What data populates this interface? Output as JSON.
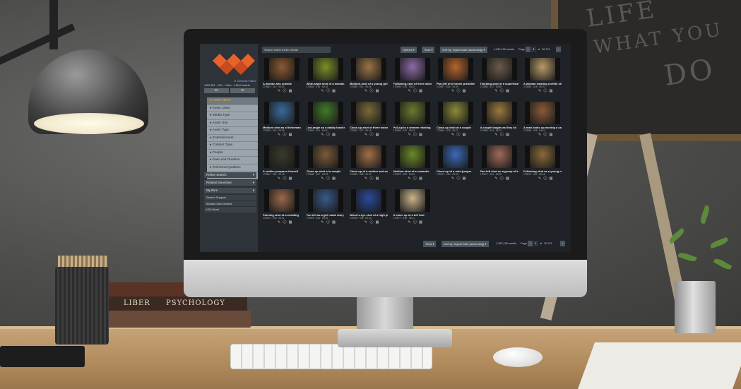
{
  "decor": {
    "chalkboard_lines": [
      "LIFE",
      "WHAT YOU",
      "DO"
    ],
    "book_spines": [
      "LIBER",
      "PSYCHOLOGY"
    ]
  },
  "sidebar": {
    "clear_link": "✕ Clear All Filters",
    "counts": "4,567,891  ·  100+  ·  Video  ·  1,234,5 assets",
    "toggles": [
      "RFI",
      "RF"
    ],
    "filters": [
      {
        "label": "Asset Filters",
        "active": true
      },
      {
        "label": "Asset Class"
      },
      {
        "label": "Media Type"
      },
      {
        "label": "Asset Use"
      },
      {
        "label": "Asset Type"
      },
      {
        "label": "Entertainment"
      },
      {
        "label": "Content Type"
      },
      {
        "label": "People"
      },
      {
        "label": "Date and Duration"
      },
      {
        "label": "Technical Qualities"
      },
      {
        "label": "Shot Qualities"
      }
    ],
    "refine_search": "Refine Search",
    "related_searches": "Related Searches",
    "my_bins": "My Bins",
    "links": [
      "Search Support",
      "Browse new content",
      "HOU feed"
    ]
  },
  "topbar": {
    "search_placeholder": "Search within these results",
    "options": "Options",
    "tools": "Tools",
    "sort": "Sort by: Ingest Date (ascending)",
    "results": "1,282,150 results",
    "page_label": "Page",
    "page_num": "1",
    "page_of": "of",
    "page_total": "20,721"
  },
  "bottombar": {
    "tools": "Tools",
    "sort": "Sort by: Ingest Date (ascending)",
    "results": "1,282,150 results",
    "page_label": "Page",
    "page_num": "1",
    "page_of": "of",
    "page_total": "20,721"
  },
  "tiles": [
    {
      "title": "A woman sits outside",
      "meta": "172653 · 012 · 00:20",
      "color": "#8a5a32"
    },
    {
      "title": "Wide-angle shot of a woman",
      "meta": "172654 · 013 · 00:14",
      "color": "#7a8f26"
    },
    {
      "title": "Medium-shot of a young girl",
      "meta": "172655 · 014 · 00:18",
      "color": "#9a7448"
    },
    {
      "title": "Following-shot of three women",
      "meta": "172656 · 015 · 00:12",
      "color": "#8d6aa6"
    },
    {
      "title": "Pan-left of a former president",
      "meta": "172657 · 016 · 00:25",
      "color": "#b4652e"
    },
    {
      "title": "Tracking-shot of a supermarket",
      "meta": "172658 · 017 · 00:09",
      "color": "#6a5a4a"
    },
    {
      "title": "A woman wearing a white shirt",
      "meta": "172659 · 018 · 00:22",
      "color": "#b99a6a"
    },
    {
      "title": "Medium shot as a fisherman",
      "meta": "172660 · 019 · 00:16",
      "color": "#3b6a9a"
    },
    {
      "title": "Low-angle as a daddy teaches",
      "meta": "172661 · 020 · 00:11",
      "color": "#3f7a2a"
    },
    {
      "title": "Close-up-shot of three women",
      "meta": "172662 · 021 · 00:19",
      "color": "#7a6a3a"
    },
    {
      "title": "Pull-up to a women relaxing",
      "meta": "172663 · 022 · 00:13",
      "color": "#6c7a2e"
    },
    {
      "title": "Close-up shot of a couple",
      "meta": "172664 · 023 · 00:17",
      "color": "#8a8a3a"
    },
    {
      "title": "A couple laughs as they sit",
      "meta": "172665 · 024 · 00:21",
      "color": "#9a7a3e"
    },
    {
      "title": "A man looks up moving a cart",
      "meta": "172666 · 025 · 00:10",
      "color": "#8a5a3a"
    },
    {
      "title": "A soldier prepares himself",
      "meta": "172667 · 026 · 00:15",
      "color": "#3a3a2a"
    },
    {
      "title": "Close-up shot of a couple",
      "meta": "172668 · 027 · 00:23",
      "color": "#7a5a3a"
    },
    {
      "title": "Close-up of a mother and son",
      "meta": "172669 · 028 · 00:12",
      "color": "#a07048"
    },
    {
      "title": "Medium-shot of a romantic",
      "meta": "172670 · 029 · 00:18",
      "color": "#6a8a2a"
    },
    {
      "title": "Close-up of a mini-jumper",
      "meta": "172671 · 030 · 00:14",
      "color": "#3a6ab8"
    },
    {
      "title": "Pan-left shot on a group of kids",
      "meta": "172672 · 031 · 00:20",
      "color": "#a06a5a"
    },
    {
      "title": "Following shot as a young man",
      "meta": "172673 · 032 · 00:16",
      "color": "#8a6a3a"
    },
    {
      "title": "Panning shot of a wedding",
      "meta": "172674 · 033 · 00:11",
      "color": "#9a6a4a"
    },
    {
      "title": "Pan left as a girl reads story",
      "meta": "172675 · 034 · 00:19",
      "color": "#3a5a8a"
    },
    {
      "title": "Worm's-eye shot of a high jump",
      "meta": "172676 · 035 · 00:13",
      "color": "#2a4a9a"
    },
    {
      "title": "A close up of a left foot",
      "meta": "172677 · 036 · 00:17",
      "color": "#c9b48a"
    }
  ]
}
